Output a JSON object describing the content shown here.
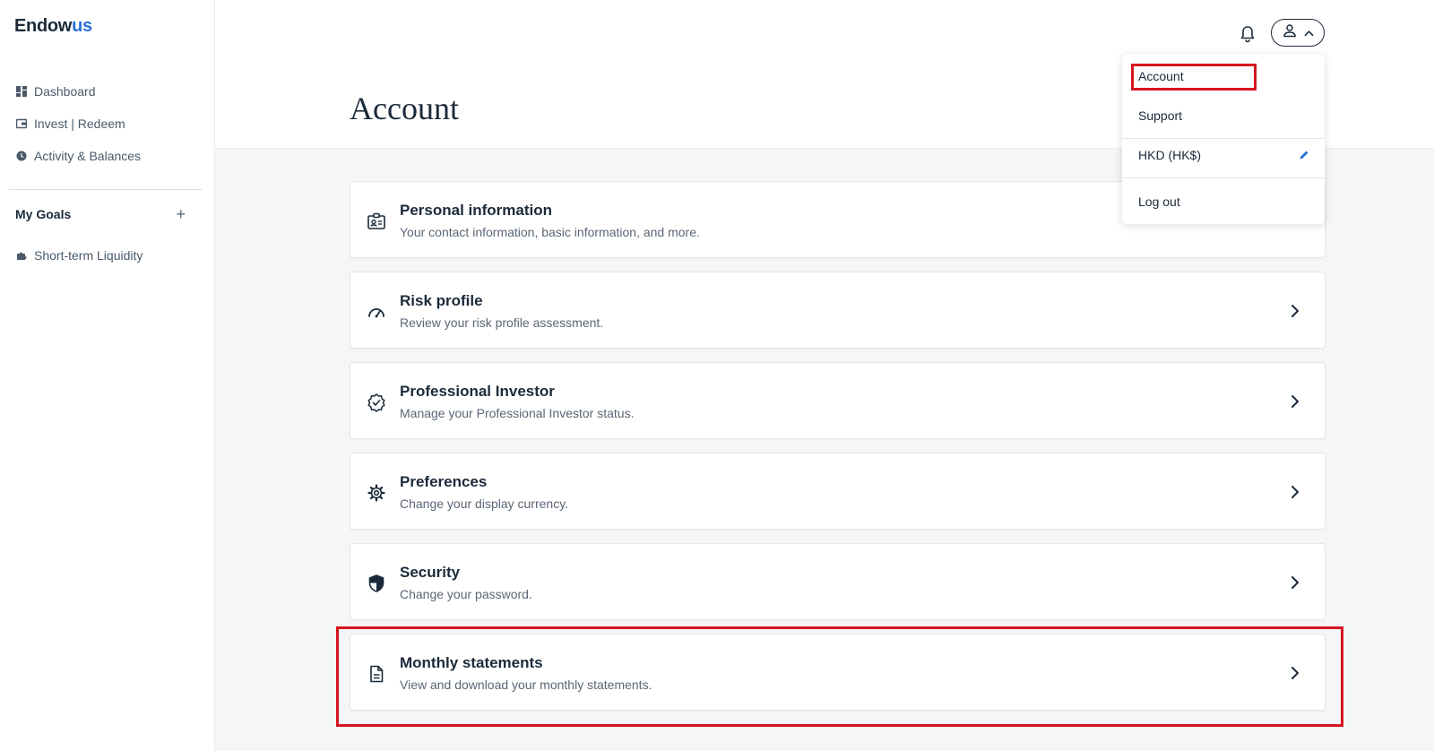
{
  "brand": {
    "name_main": "Endow",
    "name_accent": "us",
    "accent_color": "#2a6fdb"
  },
  "sidebar": {
    "items": [
      {
        "label": "Dashboard",
        "icon": "dashboard-icon"
      },
      {
        "label": "Invest | Redeem",
        "icon": "wallet-icon"
      },
      {
        "label": "Activity & Balances",
        "icon": "clock-icon"
      }
    ],
    "goals_header": "My Goals",
    "add_goal": "+",
    "goals": [
      {
        "label": "Short-term Liquidity",
        "icon": "puzzle-icon"
      }
    ]
  },
  "header": {
    "title": "Account"
  },
  "dropdown": {
    "items": [
      {
        "label": "Account"
      },
      {
        "label": "Support"
      },
      {
        "label": "HKD (HK$)"
      },
      {
        "label": "Log out"
      }
    ]
  },
  "cards": [
    {
      "title": "Personal information",
      "desc": "Your contact information, basic information, and more.",
      "icon": "id-card-icon"
    },
    {
      "title": "Risk profile",
      "desc": "Review your risk profile assessment.",
      "icon": "gauge-icon"
    },
    {
      "title": "Professional Investor",
      "desc": "Manage your Professional Investor status.",
      "icon": "verified-badge-icon"
    },
    {
      "title": "Preferences",
      "desc": "Change your display currency.",
      "icon": "gear-icon"
    },
    {
      "title": "Security",
      "desc": "Change your password.",
      "icon": "shield-icon"
    },
    {
      "title": "Monthly statements",
      "desc": "View and download your monthly statements.",
      "icon": "document-icon"
    }
  ],
  "colors": {
    "highlight": "#d6151f",
    "background": "#f4f6f8",
    "text": "#1b2a3a"
  }
}
